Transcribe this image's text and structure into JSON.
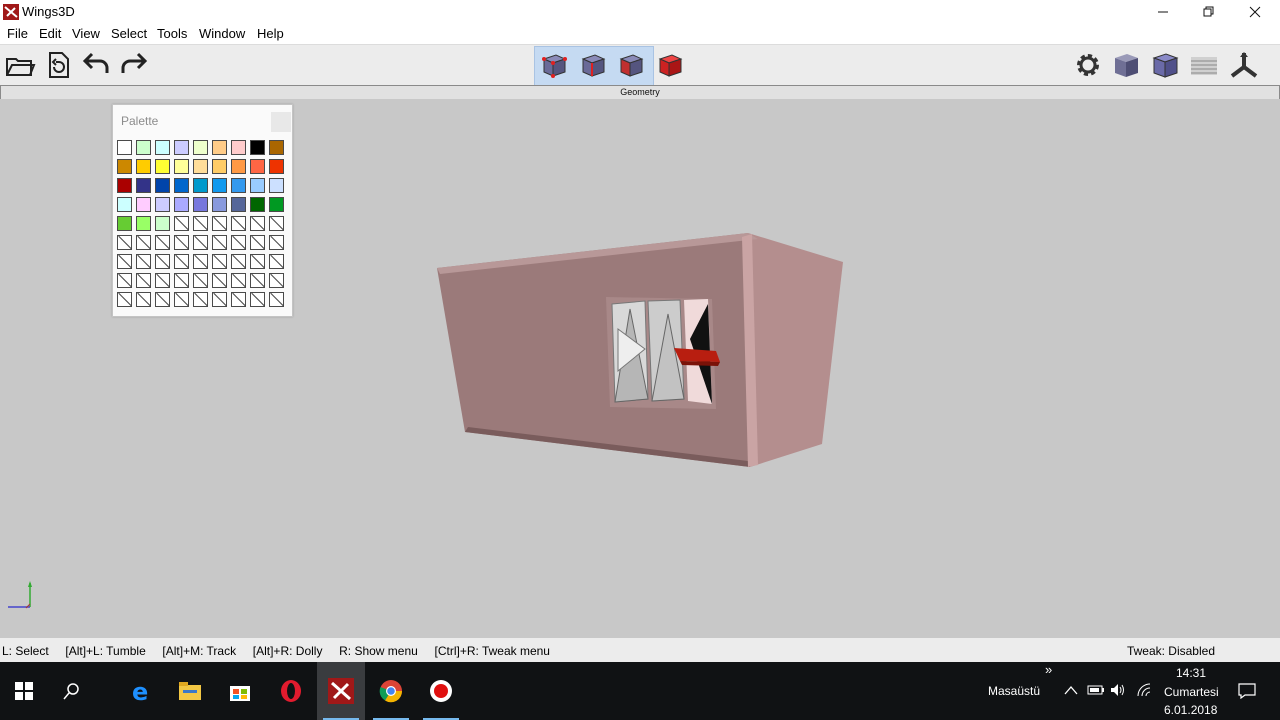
{
  "window": {
    "title": "Wings3D"
  },
  "menu": [
    "File",
    "Edit",
    "View",
    "Select",
    "Tools",
    "Window",
    "Help"
  ],
  "geometry_tab": "Geometry",
  "palette": {
    "title": "Palette",
    "rows": [
      [
        "#ffffff",
        "#ccffcc",
        "#ccffff",
        "#ccccff",
        "#eeffcc",
        "#ffcc88",
        "#ffcccc",
        "#000000",
        "#aa6600"
      ],
      [
        "#cc8800",
        "#ffcc00",
        "#ffff33",
        "#ffff99",
        "#ffdd99",
        "#ffcc66",
        "#ff9944",
        "#ff6644",
        "#ee3300"
      ],
      [
        "#aa0000",
        "#333388",
        "#0044aa",
        "#0066cc",
        "#0099cc",
        "#1199ee",
        "#3399ee",
        "#99ccff",
        "#cce0ff"
      ],
      [
        "#ccffff",
        "#ffccff",
        "#ccccff",
        "#aaaaff",
        "#7777dd",
        "#8899dd",
        "#556699",
        "#006600",
        "#009922"
      ],
      [
        "#66cc33",
        "#99ff66",
        "#ccffcc",
        "",
        "",
        "",
        "",
        "",
        ""
      ],
      [
        "",
        "",
        "",
        "",
        "",
        "",
        "",
        "",
        ""
      ],
      [
        "",
        "",
        "",
        "",
        "",
        "",
        "",
        "",
        ""
      ],
      [
        "",
        "",
        "",
        "",
        "",
        "",
        "",
        "",
        ""
      ],
      [
        "",
        "",
        "",
        "",
        "",
        "",
        "",
        "",
        ""
      ]
    ]
  },
  "status": {
    "hints": "L: Select     [Alt]+L: Tumble     [Alt]+M: Track     [Alt]+R: Dolly     R: Show menu     [Ctrl]+R: Tweak menu",
    "tweak": "Tweak: Disabled"
  },
  "tray": {
    "desktop_label": "Masaüstü",
    "time": "14:31",
    "day": "Cumartesi",
    "date": "6.01.2018",
    "chevron": "»"
  },
  "colors": {
    "model": "#9b7a7a",
    "viewport": "#c8c8c8",
    "accent": "#e02020"
  }
}
